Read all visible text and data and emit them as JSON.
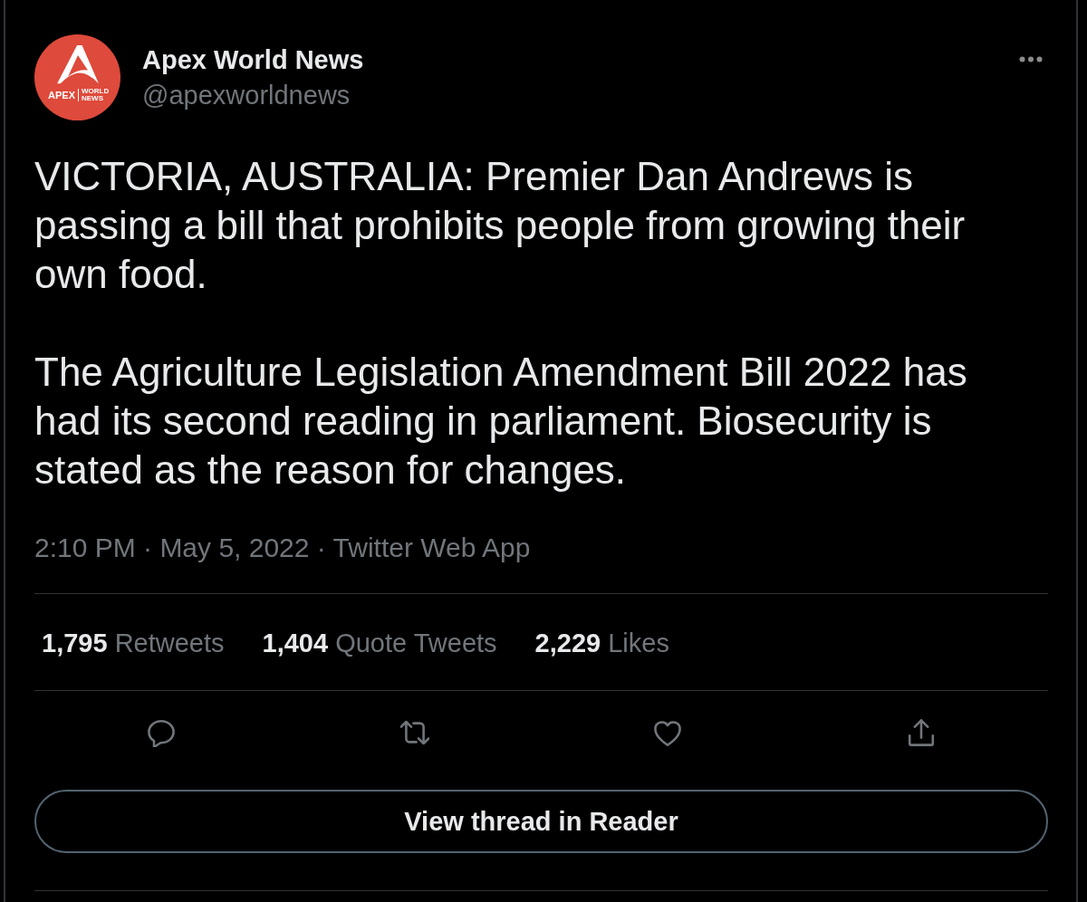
{
  "author": {
    "name": "Apex World News",
    "handle": "@apexworldnews",
    "avatar": {
      "wordmark": "APEX",
      "tagline": "WORLD NEWS"
    }
  },
  "tweet": {
    "paragraphs": [
      "VICTORIA, AUSTRALIA: Premier Dan Andrews is passing a bill that prohibits people from growing their own food.",
      "The Agriculture Legislation Amendment Bill 2022 has had its second reading in parliament. Biosecurity is stated as the reason for changes."
    ],
    "timestamp": "2:10 PM · May 5, 2022 · Twitter Web App"
  },
  "stats": [
    {
      "count": "1,795",
      "label": "Retweets"
    },
    {
      "count": "1,404",
      "label": "Quote Tweets"
    },
    {
      "count": "2,229",
      "label": "Likes"
    }
  ],
  "actions": [
    {
      "kind": "reply"
    },
    {
      "kind": "retweet"
    },
    {
      "kind": "like"
    },
    {
      "kind": "share"
    }
  ],
  "thread_button": {
    "label": "View thread in Reader"
  }
}
